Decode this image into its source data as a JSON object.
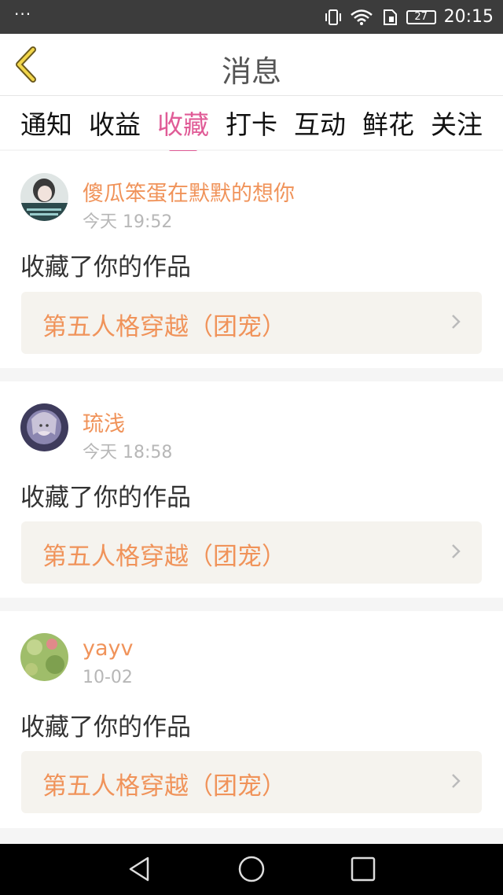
{
  "status_bar": {
    "left": "···",
    "battery": "27",
    "time": "20:15"
  },
  "header": {
    "title": "消息"
  },
  "tabs": [
    {
      "label": "通知",
      "active": false
    },
    {
      "label": "收益",
      "active": false
    },
    {
      "label": "收藏",
      "active": true
    },
    {
      "label": "打卡",
      "active": false
    },
    {
      "label": "互动",
      "active": false
    },
    {
      "label": "鲜花",
      "active": false
    },
    {
      "label": "关注",
      "active": false
    }
  ],
  "messages": [
    {
      "username": "傻瓜笨蛋在默默的想你",
      "time": "今天 19:52",
      "action": "收藏了你的作品",
      "work_title": "第五人格穿越（团宠）"
    },
    {
      "username": "琉浅",
      "time": "今天 18:58",
      "action": "收藏了你的作品",
      "work_title": "第五人格穿越（团宠）"
    },
    {
      "username": "yayv",
      "time": "10-02",
      "action": "收藏了你的作品",
      "work_title": "第五人格穿越（团宠）"
    }
  ],
  "colors": {
    "accent": "#e05c97",
    "name": "#f0935a"
  }
}
